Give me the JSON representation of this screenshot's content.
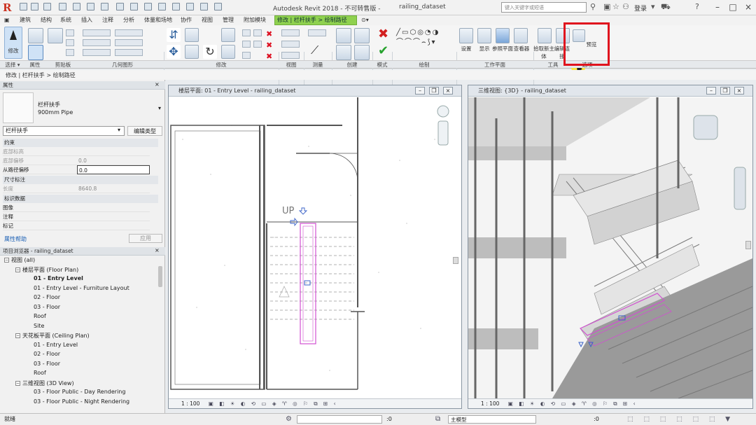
{
  "app": {
    "title": "Autodesk Revit 2018 - 不可转售版 -",
    "filename": "railing_dataset",
    "search_placeholder": "键入关键字或短语",
    "login": "登录"
  },
  "tabs": [
    "建筑",
    "结构",
    "系统",
    "插入",
    "注释",
    "分析",
    "体量和场地",
    "协作",
    "视图",
    "管理",
    "附加模块"
  ],
  "context_tab": "修改 | 栏杆扶手 > 绘制路径",
  "ribbon": {
    "modify_label": "修改",
    "select_label": "选择 ▾",
    "properties_label": "属性",
    "clipboard_label": "剪贴板",
    "geometry_label": "几何图形",
    "modify_panel_label": "修改",
    "view_label": "视图",
    "measure_label": "测量",
    "create_label": "创建",
    "mode_label": "模式",
    "draw_label": "绘制",
    "workplane_label": "工作平面",
    "tools_label": "工具",
    "options_label": "选项",
    "set_label": "设置",
    "show_label": "显示",
    "ref_plane_label": "参照平面",
    "viewer_label": "查看器",
    "pick_host_label": "拾取新主体",
    "edit_path_label": "编辑连接",
    "preview_label": "预览"
  },
  "breadcrumb": "修改 | 栏杆扶手 > 绘制路径",
  "properties": {
    "header": "属性",
    "type_name": "栏杆扶手",
    "type_sub": "900mm Pipe",
    "selector_value": "栏杆扶手",
    "edit_type": "编辑类型",
    "group_constraints": "约束",
    "group_dimensions": "尺寸标注",
    "group_identity": "标识数据",
    "rows": [
      {
        "label": "底部标高",
        "value": ""
      },
      {
        "label": "底部偏移",
        "value": "0.0"
      },
      {
        "label": "从路径偏移",
        "value": "0.0"
      },
      {
        "label": "长度",
        "value": "8640.8"
      },
      {
        "label": "图像",
        "value": ""
      },
      {
        "label": "注释",
        "value": ""
      },
      {
        "label": "标记",
        "value": ""
      }
    ],
    "help_link": "属性帮助",
    "apply_button": "应用"
  },
  "project_browser": {
    "header": "项目浏览器 - railing_dataset",
    "items": [
      {
        "label": "视图 (all)",
        "level": 0,
        "expander": "−"
      },
      {
        "label": "楼层平面 (Floor Plan)",
        "level": 1,
        "expander": "−"
      },
      {
        "label": "01 - Entry Level",
        "level": 2,
        "expander": ""
      },
      {
        "label": "01 - Entry Level - Furniture Layout",
        "level": 2,
        "expander": ""
      },
      {
        "label": "02 - Floor",
        "level": 2,
        "expander": ""
      },
      {
        "label": "03 - Floor",
        "level": 2,
        "expander": ""
      },
      {
        "label": "Roof",
        "level": 2,
        "expander": ""
      },
      {
        "label": "Site",
        "level": 2,
        "expander": ""
      },
      {
        "label": "天花板平面 (Ceiling Plan)",
        "level": 1,
        "expander": "−"
      },
      {
        "label": "01 - Entry Level",
        "level": 2,
        "expander": ""
      },
      {
        "label": "02 - Floor",
        "level": 2,
        "expander": ""
      },
      {
        "label": "03 - Floor",
        "level": 2,
        "expander": ""
      },
      {
        "label": "Roof",
        "level": 2,
        "expander": ""
      },
      {
        "label": "三维视图 (3D View)",
        "level": 1,
        "expander": "−"
      },
      {
        "label": "03 - Floor Public - Day Rendering",
        "level": 2,
        "expander": ""
      },
      {
        "label": "03 - Floor Public - Night Rendering",
        "level": 2,
        "expander": ""
      }
    ]
  },
  "views": {
    "plan_title": "楼层平面: 01 - Entry Level - railing_dataset",
    "view3d_title": "三维视图: {3D} - railing_dataset",
    "plan_scale": "1 : 100",
    "view3d_scale": "1 : 100",
    "up_label": "UP"
  },
  "status": {
    "ready": "就绪",
    "zero1": ":0",
    "model": "主模型",
    "zero2": ":0"
  }
}
